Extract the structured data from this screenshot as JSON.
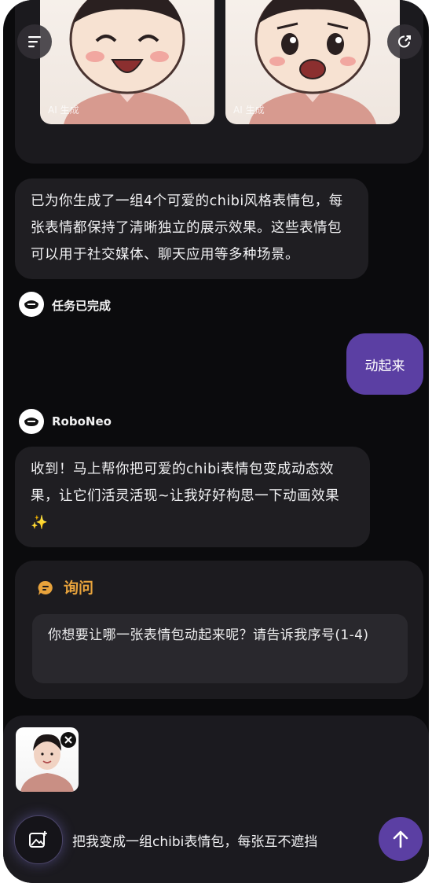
{
  "images": {
    "watermark": "AI 生成"
  },
  "messages": {
    "assistant_summary": "已为你生成了一组4个可爱的chibi风格表情包，每张表情都保持了清晰独立的展示效果。这些表情包可以用于社交媒体、聊天应用等多种场景。",
    "task_status": "任务已完成",
    "user_message": "动起来",
    "bot_name": "RoboNeo",
    "assistant_reply": "收到！马上帮你把可爱的chibi表情包变成动态效果，让它们活灵活现~让我好好构思一下动画效果✨"
  },
  "ask_card": {
    "title": "询问",
    "question": "你想要让哪一张表情包动起来呢？请告诉我序号(1-4)"
  },
  "composer": {
    "input_text": "把我变成一组chibi表情包，每张互不遮挡"
  },
  "colors": {
    "accent_purple": "#5b3fa3",
    "ask_orange": "#e8a33c"
  },
  "icons": [
    "menu-icon",
    "share-icon",
    "robot-avatar-icon",
    "chat-bubble-icon",
    "close-icon",
    "image-add-icon",
    "arrow-up-icon"
  ]
}
